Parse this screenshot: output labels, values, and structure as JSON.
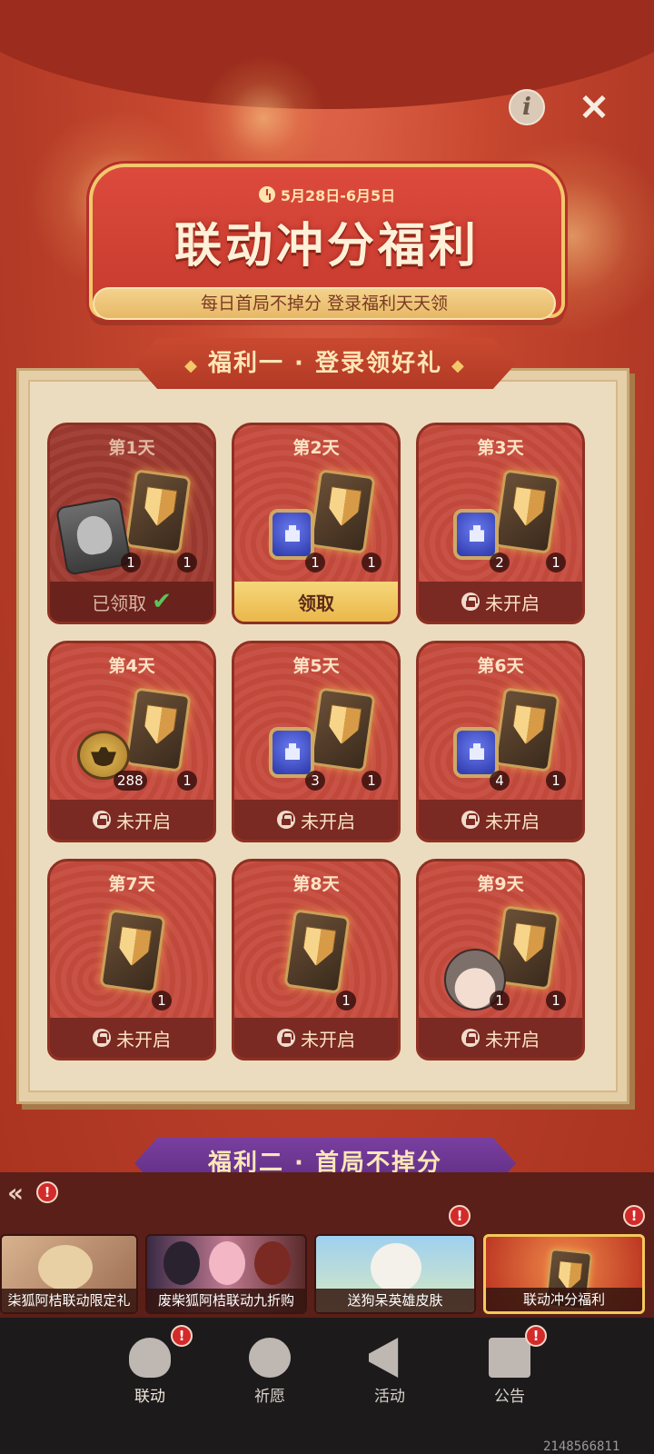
{
  "header": {
    "date_range": "5月28日-6月5日",
    "title": "联动冲分福利",
    "subtitle": "每日首局不掉分 登录福利天天领"
  },
  "top_buttons": {
    "info": "i",
    "close": "✕"
  },
  "section1": {
    "title": "福利一 · 登录领好礼",
    "diamond": "◆"
  },
  "section2": {
    "title": "福利二 · 首局不掉分"
  },
  "days": [
    {
      "label": "第1天",
      "status": "已领取",
      "items": [
        "1",
        "1"
      ]
    },
    {
      "label": "第2天",
      "status": "领取",
      "items": [
        "1",
        "1"
      ]
    },
    {
      "label": "第3天",
      "status": "未开启",
      "items": [
        "2",
        "1"
      ]
    },
    {
      "label": "第4天",
      "status": "未开启",
      "items": [
        "288",
        "1"
      ]
    },
    {
      "label": "第5天",
      "status": "未开启",
      "items": [
        "3",
        "1"
      ]
    },
    {
      "label": "第6天",
      "status": "未开启",
      "items": [
        "4",
        "1"
      ]
    },
    {
      "label": "第7天",
      "status": "未开启",
      "items": [
        "1"
      ]
    },
    {
      "label": "第8天",
      "status": "未开启",
      "items": [
        "1"
      ]
    },
    {
      "label": "第9天",
      "status": "未开启",
      "items": [
        "1",
        "1"
      ]
    }
  ],
  "promos": [
    {
      "label": "柒狐阿桔联动限定礼"
    },
    {
      "label": "废柴狐阿桔联动九折购"
    },
    {
      "label": "送狗呆英雄皮肤"
    },
    {
      "label": "联动冲分福利"
    }
  ],
  "collapse_label": "«",
  "badge_text": "!",
  "nav": [
    {
      "label": "联动",
      "icon": "fox-icon"
    },
    {
      "label": "祈愿",
      "icon": "crystal-ball-icon"
    },
    {
      "label": "活动",
      "icon": "megaphone-icon"
    },
    {
      "label": "公告",
      "icon": "notice-icon"
    }
  ],
  "uid": "2148566811",
  "colors": {
    "accent_red": "#c64b3e",
    "gold": "#f2c86b",
    "claim_yellow": "#eab74b"
  }
}
